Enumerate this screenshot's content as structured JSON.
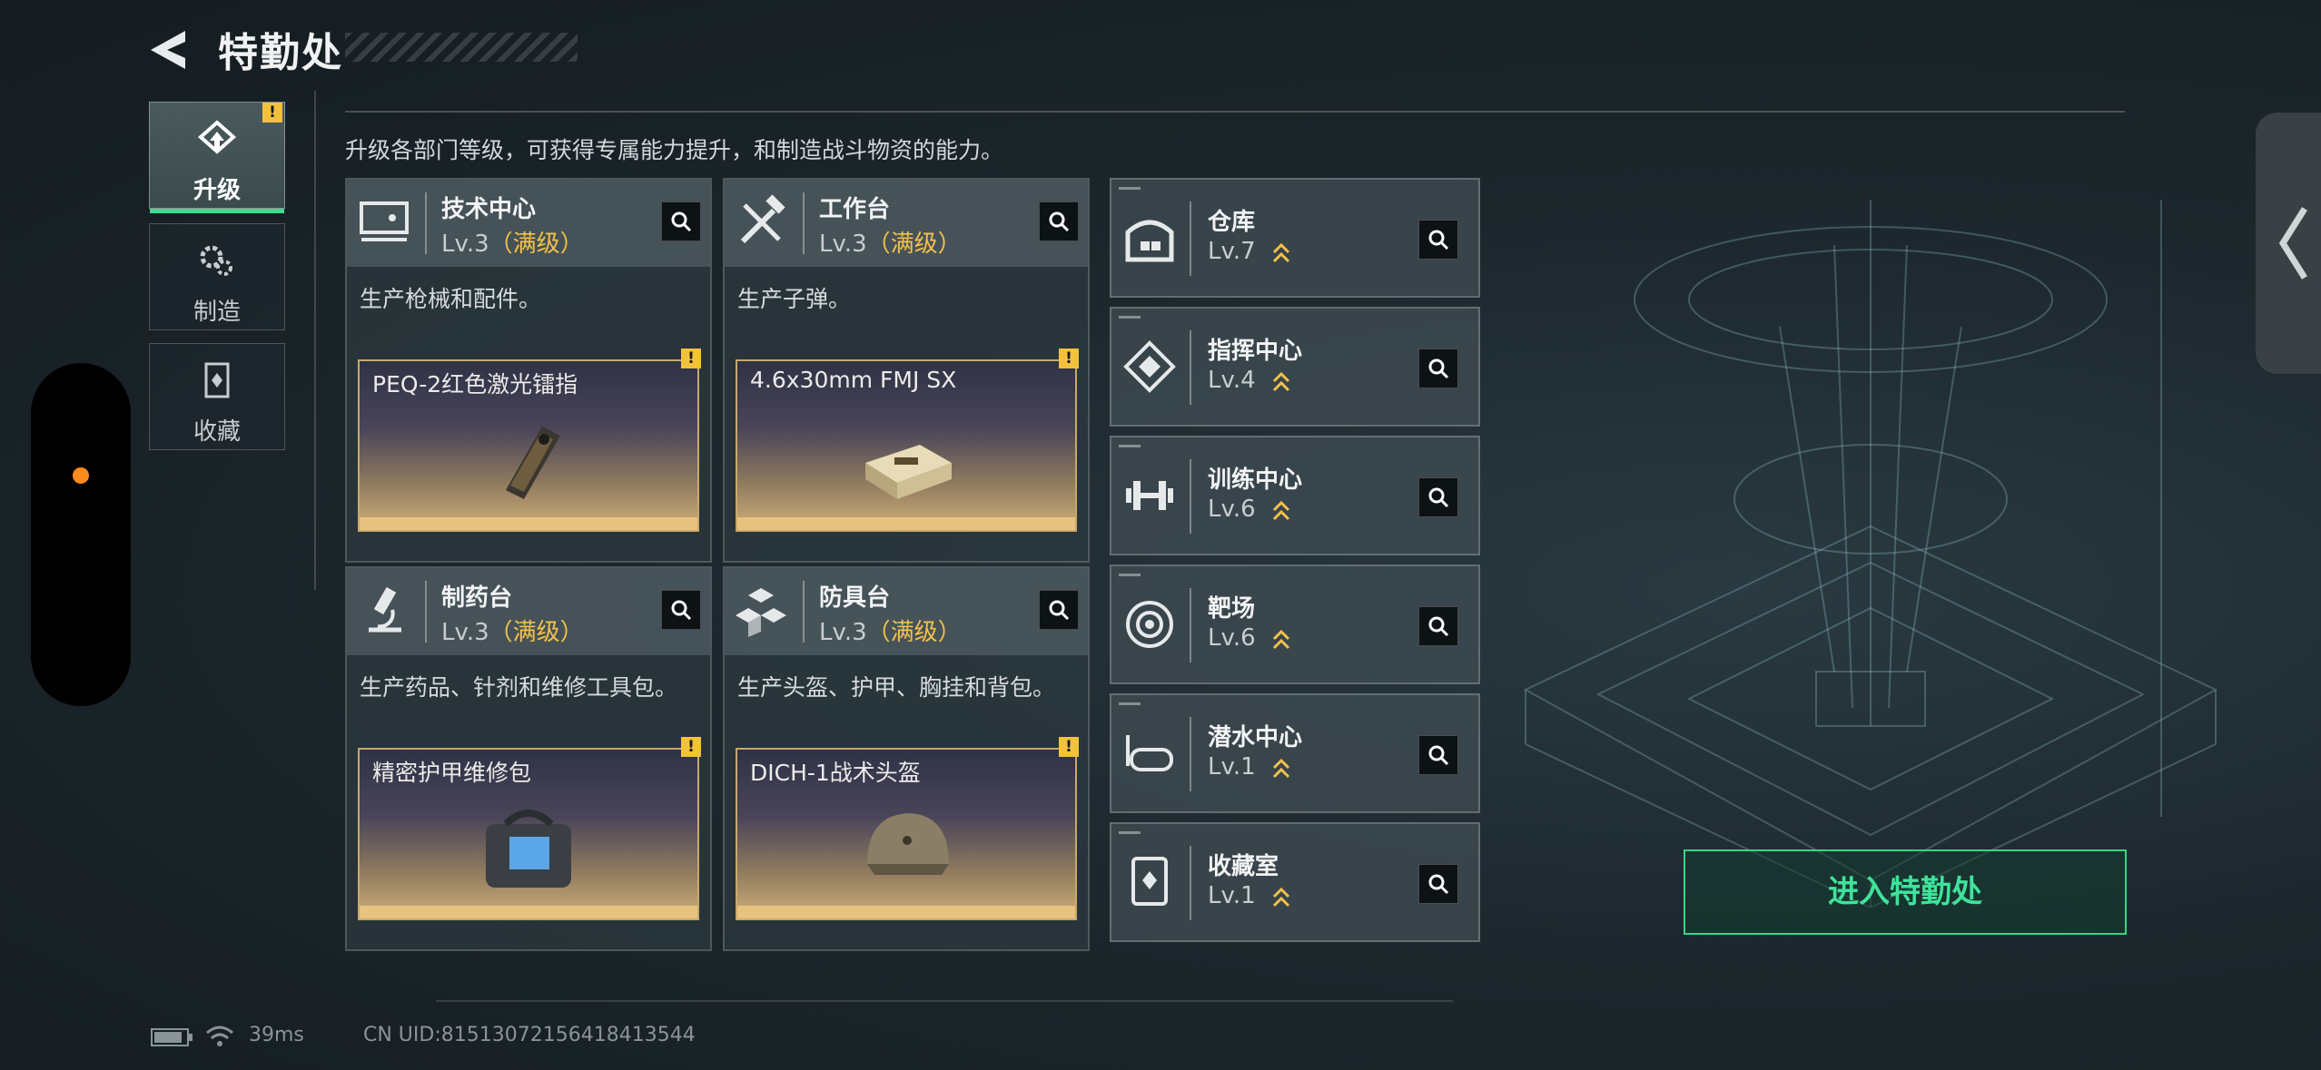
{
  "header": {
    "title": "特勤处"
  },
  "tabs": [
    {
      "label": "升级",
      "icon": "upgrade-icon",
      "active": true,
      "badge": "!"
    },
    {
      "label": "制造",
      "icon": "gears-icon",
      "active": false
    },
    {
      "label": "收藏",
      "icon": "collection-icon",
      "active": false
    }
  ],
  "intro": "升级各部门等级，可获得专属能力提升，和制造战斗物资的能力。",
  "workshops": [
    {
      "name": "技术中心",
      "level": "Lv.3",
      "max_label": "（满级）",
      "icon": "monitor-icon",
      "desc": "生产枪械和配件。",
      "item": "PEQ-2红色激光镭指",
      "item_icon": "laser-sight-icon",
      "badge": "!"
    },
    {
      "name": "工作台",
      "level": "Lv.3",
      "max_label": "（满级）",
      "icon": "tools-icon",
      "desc": "生产子弹。",
      "item": "4.6x30mm FMJ SX",
      "item_icon": "ammo-box-icon",
      "badge": "!"
    },
    {
      "name": "制药台",
      "level": "Lv.3",
      "max_label": "（满级）",
      "icon": "microscope-icon",
      "desc": "生产药品、针剂和维修工具包。",
      "item": "精密护甲维修包",
      "item_icon": "repair-kit-icon",
      "badge": "!"
    },
    {
      "name": "防具台",
      "level": "Lv.3",
      "max_label": "（满级）",
      "icon": "armor-blocks-icon",
      "desc": "生产头盔、护甲、胸挂和背包。",
      "item": "DICH-1战术头盔",
      "item_icon": "helmet-icon",
      "badge": "!"
    }
  ],
  "buildings": [
    {
      "name": "仓库",
      "level": "Lv.7",
      "icon": "warehouse-icon"
    },
    {
      "name": "指挥中心",
      "level": "Lv.4",
      "icon": "command-icon"
    },
    {
      "name": "训练中心",
      "level": "Lv.6",
      "icon": "dumbbell-icon"
    },
    {
      "name": "靶场",
      "level": "Lv.6",
      "icon": "target-icon"
    },
    {
      "name": "潜水中心",
      "level": "Lv.1",
      "icon": "diving-mask-icon"
    },
    {
      "name": "收藏室",
      "level": "Lv.1",
      "icon": "trophy-icon"
    }
  ],
  "enter_button": "进入特勤处",
  "status": {
    "ping": "39ms",
    "uid": "CN UID:815130721564184135​44"
  },
  "colors": {
    "accent_green": "#3ddc8f",
    "max_gold": "#f2c14a",
    "warn": "#f3c23b",
    "item_frame": "#c9a969"
  }
}
